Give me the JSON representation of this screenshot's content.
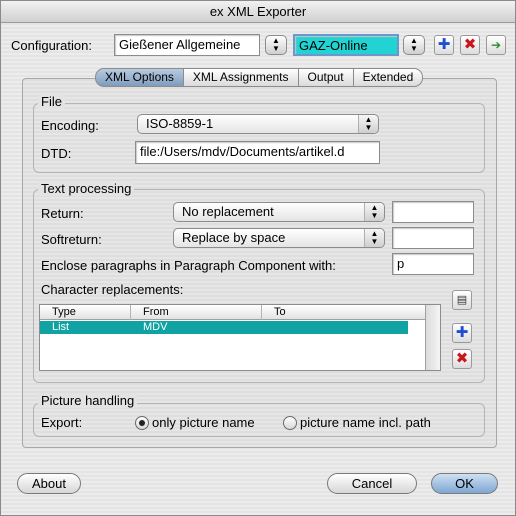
{
  "window": {
    "title": "ex XML Exporter"
  },
  "configuration": {
    "label": "Configuration:",
    "primary_value": "Gießener Allgemeine",
    "secondary_value": "GAZ-Online",
    "secondary_color": "#22d3d3"
  },
  "toolbar": {
    "add_icon": "plus-icon",
    "delete_icon": "x-icon",
    "export_icon": "export-arrow-icon"
  },
  "tabs": [
    {
      "label": "XML Options",
      "selected": true
    },
    {
      "label": "XML Assignments",
      "selected": false
    },
    {
      "label": "Output",
      "selected": false
    },
    {
      "label": "Extended",
      "selected": false
    }
  ],
  "file_group": {
    "title": "File",
    "encoding_label": "Encoding:",
    "encoding_value": "ISO-8859-1",
    "dtd_label": "DTD:",
    "dtd_value": "file:/Users/mdv/Documents/artikel.d"
  },
  "text_processing": {
    "title": "Text processing",
    "return_label": "Return:",
    "return_value": "No replacement",
    "return_text": "",
    "softreturn_label": "Softreturn:",
    "softreturn_value": "Replace by space",
    "softreturn_text": "",
    "enclose_label": "Enclose paragraphs in Paragraph Component with:",
    "enclose_value": "p",
    "char_repl_label": "Character replacements:",
    "columns": [
      "Type",
      "From",
      "To"
    ],
    "rows": [
      {
        "type": "List",
        "from": "MDV",
        "to": ""
      }
    ],
    "selection_color": "#11a3a3"
  },
  "picture_handling": {
    "title": "Picture handling",
    "export_label": "Export:",
    "option_name_only": "only picture name",
    "option_incl_path": "picture name incl. path",
    "selected": "only picture name"
  },
  "buttons": {
    "about": "About",
    "cancel": "Cancel",
    "ok": "OK"
  }
}
